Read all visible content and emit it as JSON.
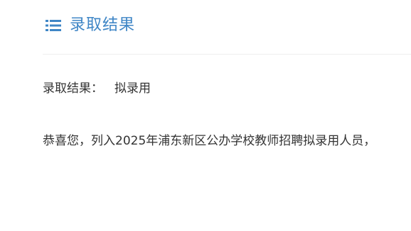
{
  "section": {
    "icon": "list-icon",
    "title": "录取结果",
    "accent_color": "#3f86c6"
  },
  "result": {
    "label": "录取结果：",
    "value": "拟录用"
  },
  "message": "恭喜您，列入2025年浦东新区公办学校教师招聘拟录用人员，"
}
